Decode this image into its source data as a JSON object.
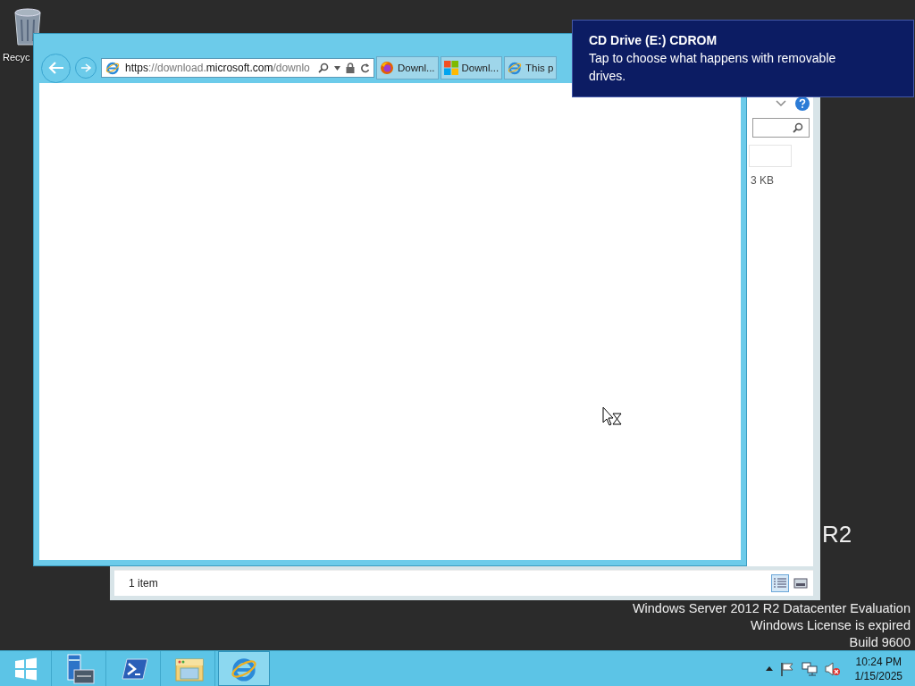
{
  "desktop": {
    "icons": [
      {
        "kind": "recycle-bin",
        "label": "Recyc"
      }
    ],
    "watermark": {
      "fragment": "R2",
      "lines": [
        "Windows Server 2012 R2 Datacenter Evaluation",
        "Windows License is expired",
        "Build 9600"
      ]
    }
  },
  "explorer_window": {
    "file_size": "3 KB",
    "status": "1 item",
    "views": [
      {
        "kind": "details",
        "selected": true
      },
      {
        "kind": "preview",
        "selected": false
      }
    ]
  },
  "browser": {
    "address": [
      {
        "text": "https",
        "emphasis": true
      },
      {
        "text": "://download.",
        "emphasis": false
      },
      {
        "text": "microsoft.com",
        "emphasis": true
      },
      {
        "text": "/downlo",
        "emphasis": false
      }
    ],
    "tabs": [
      {
        "kind": "firefox",
        "label": "Downl..."
      },
      {
        "kind": "microsoft",
        "label": "Downl..."
      },
      {
        "kind": "ie",
        "label": "This p"
      }
    ]
  },
  "notification": {
    "title": "CD Drive (E:) CDROM",
    "message": "Tap to choose what happens with removable drives."
  },
  "taskbar": {
    "apps": [
      {
        "kind": "start",
        "selected": false
      },
      {
        "kind": "server-manager",
        "selected": false
      },
      {
        "kind": "powershell",
        "selected": false
      },
      {
        "kind": "file-explorer",
        "selected": false
      },
      {
        "kind": "ie",
        "selected": true
      }
    ],
    "clock": {
      "time": "10:24 PM",
      "date": "1/15/2025"
    }
  }
}
